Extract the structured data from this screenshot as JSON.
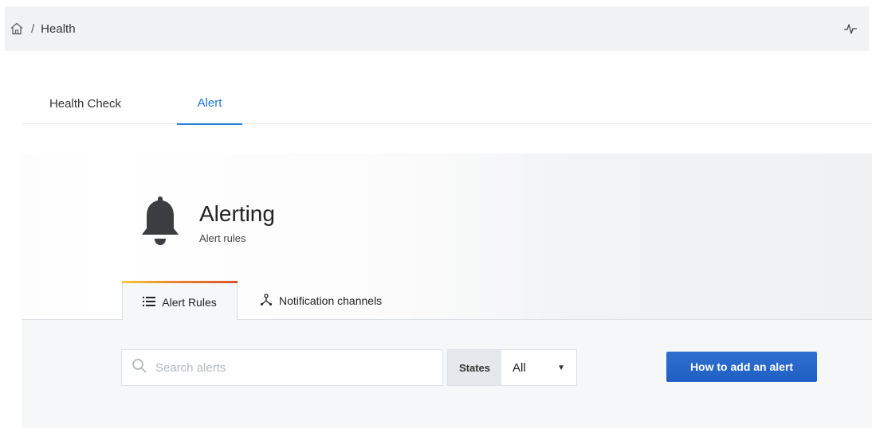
{
  "breadcrumb": {
    "home_icon": "home-icon",
    "separator": "/",
    "current": "Health"
  },
  "header": {
    "pulse_icon": "heartbeat-icon"
  },
  "tabs": [
    {
      "label": "Health Check",
      "active": false
    },
    {
      "label": "Alert",
      "active": true
    }
  ],
  "panel": {
    "icon": "bell-icon",
    "title": "Alerting",
    "subtitle": "Alert rules",
    "subtabs": [
      {
        "label": "Alert Rules",
        "icon": "list-icon",
        "active": true
      },
      {
        "label": "Notification channels",
        "icon": "share-nodes-icon",
        "active": false
      }
    ]
  },
  "filters": {
    "search_placeholder": "Search alerts",
    "states_label": "States",
    "states_value": "All"
  },
  "actions": {
    "add_alert_label": "How to add an alert"
  },
  "colors": {
    "accent": "#1a73d9",
    "primary_button": "#2466cc",
    "tab_gradient": [
      "#f7c640",
      "#e8812a",
      "#d9532c"
    ]
  }
}
